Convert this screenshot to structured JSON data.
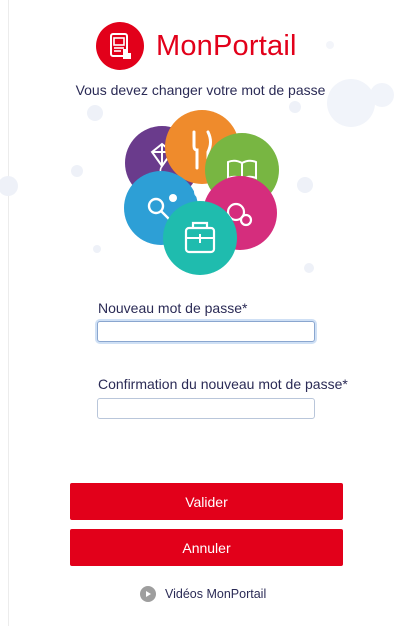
{
  "app": {
    "name": "MonPortail",
    "brand_color": "#e2001a"
  },
  "header": {
    "subtitle": "Vous devez changer votre mot de passe"
  },
  "form": {
    "new_password": {
      "label": "Nouveau mot de passe*",
      "value": "",
      "placeholder": ""
    },
    "confirm_password": {
      "label": "Confirmation du nouveau mot de passe*",
      "value": "",
      "placeholder": ""
    }
  },
  "buttons": {
    "submit_label": "Valider",
    "cancel_label": "Annuler"
  },
  "footer": {
    "videos_label": "Vidéos MonPortail"
  },
  "illustration": {
    "petals": [
      {
        "icon": "kite-icon",
        "color": "#6a3b8c"
      },
      {
        "icon": "fork-knife-icon",
        "color": "#ef8b2c"
      },
      {
        "icon": "book-icon",
        "color": "#78b642"
      },
      {
        "icon": "pacifier-icon",
        "color": "#d52d7d"
      },
      {
        "icon": "backpack-icon",
        "color": "#1fbcae"
      },
      {
        "icon": "rattle-icon",
        "color": "#2d9fd6"
      }
    ]
  }
}
